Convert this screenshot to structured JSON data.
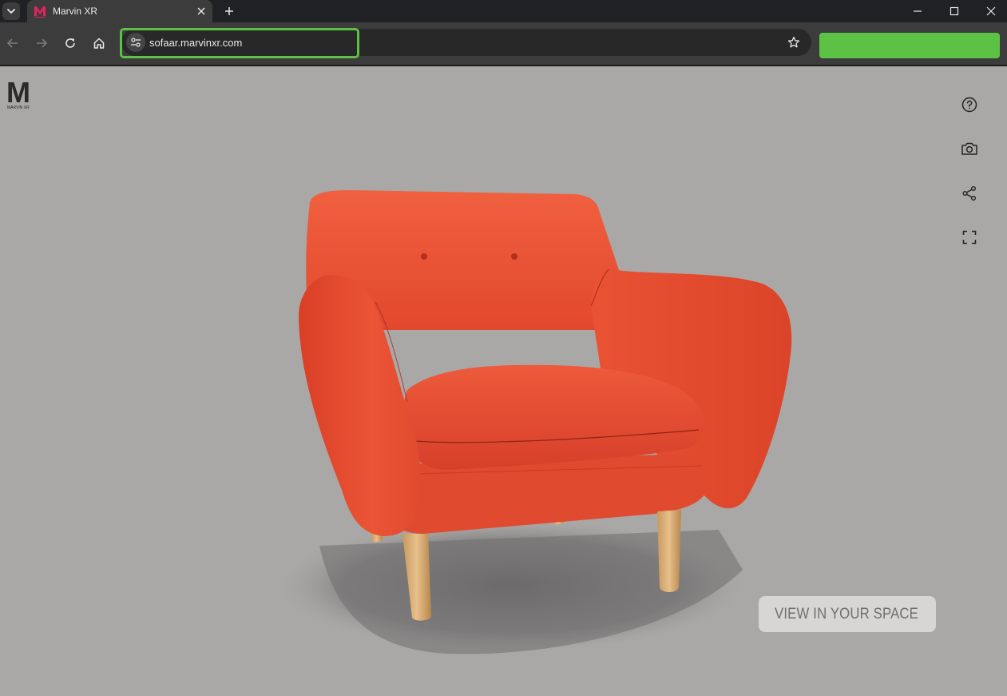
{
  "browser": {
    "tab": {
      "title": "Marvin XR",
      "favicon": "marvin-xr-favicon"
    },
    "address_bar": {
      "url": "sofaar.marvinxr.com"
    },
    "icons": {
      "tab_search": "chevron-down-icon",
      "new_tab": "plus-icon",
      "back": "arrow-left-icon",
      "forward": "arrow-right-icon",
      "reload": "reload-icon",
      "home": "home-icon",
      "site_info": "tune-icon",
      "bookmark": "star-icon",
      "minimize": "minimize-icon",
      "maximize": "maximize-icon",
      "close": "close-icon"
    },
    "highlight_color": "#5cc245"
  },
  "viewer": {
    "brand": {
      "logo": "marvin-logo",
      "letter": "M",
      "tagline": "MARVIN XR"
    },
    "tools": [
      {
        "name": "help",
        "icon": "help-circle-icon"
      },
      {
        "name": "screenshot",
        "icon": "camera-icon"
      },
      {
        "name": "share",
        "icon": "share-icon"
      },
      {
        "name": "fullscreen",
        "icon": "fullscreen-icon"
      }
    ],
    "ar_button": {
      "label": "VIEW IN YOUR SPACE",
      "icon": "ar-phone-cube-icon"
    },
    "background_color": "#aaa8a7",
    "product_color": "#e8492f"
  }
}
